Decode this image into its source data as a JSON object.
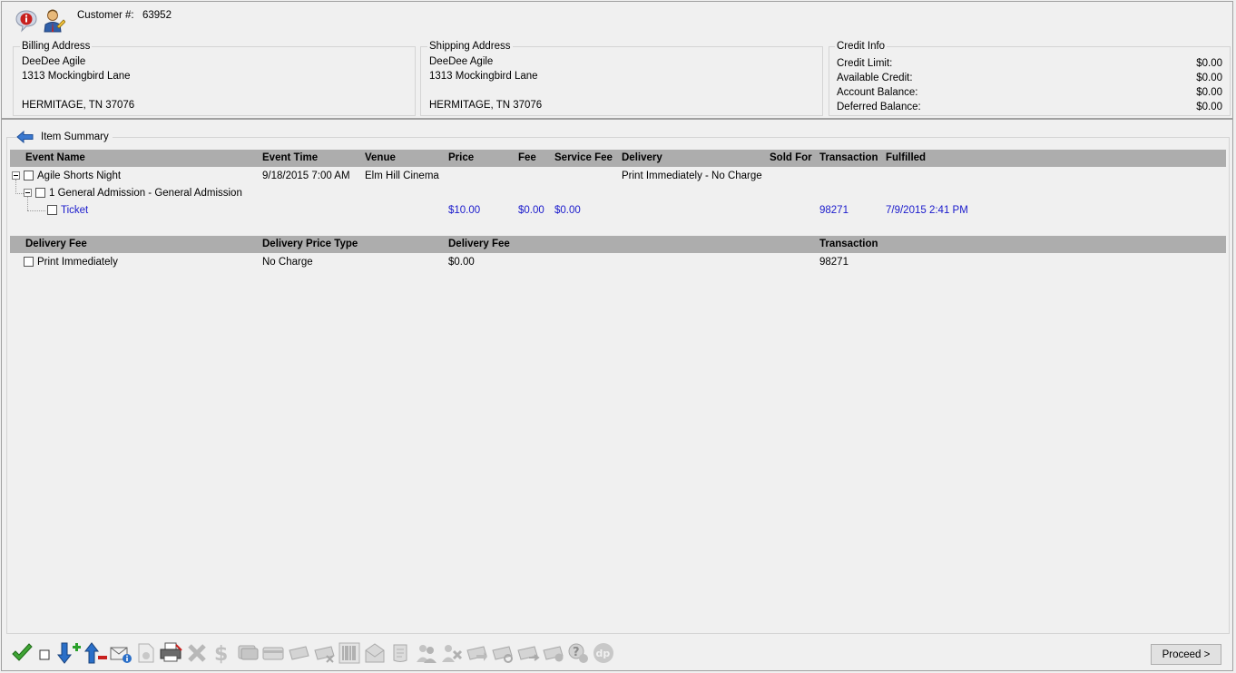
{
  "customer": {
    "label": "Customer #:",
    "number": "63952"
  },
  "billing": {
    "title": "Billing Address",
    "name": "DeeDee Agile",
    "street": "1313 Mockingbird Lane",
    "city": "HERMITAGE, TN 37076"
  },
  "shipping": {
    "title": "Shipping Address",
    "name": "DeeDee Agile",
    "street": "1313 Mockingbird Lane",
    "city": "HERMITAGE, TN 37076"
  },
  "credit": {
    "title": "Credit Info",
    "rows": [
      {
        "label": "Credit Limit:",
        "value": "$0.00"
      },
      {
        "label": "Available Credit:",
        "value": "$0.00"
      },
      {
        "label": "Account Balance:",
        "value": "$0.00"
      },
      {
        "label": "Deferred Balance:",
        "value": "$0.00"
      }
    ]
  },
  "summary": {
    "title": "Item Summary",
    "columns": [
      "Event Name",
      "Event Time",
      "Venue",
      "Price",
      "Fee",
      "Service Fee",
      "Delivery",
      "Sold For",
      "Transaction",
      "Fulfilled"
    ],
    "event": {
      "name": "Agile Shorts Night",
      "time": "9/18/2015 7:00 AM",
      "venue": "Elm Hill Cinema",
      "delivery": "Print Immediately - No Charge"
    },
    "admission": {
      "label": "1 General Admission - General Admission"
    },
    "ticket": {
      "label": "Ticket",
      "price": "$10.00",
      "fee": "$0.00",
      "service_fee": "$0.00",
      "transaction": "98271",
      "fulfilled": "7/9/2015 2:41 PM"
    }
  },
  "delivery_grid": {
    "columns": [
      "Delivery Fee",
      "Delivery Price Type",
      "Delivery Fee",
      "Transaction"
    ],
    "row": {
      "name": "Print Immediately",
      "price_type": "No Charge",
      "fee": "$0.00",
      "transaction": "98271"
    }
  },
  "toolbar": {
    "proceed_label": "Proceed >",
    "icons": [
      "check-icon",
      "checkbox-icon",
      "move-down-add-icon",
      "move-up-remove-icon",
      "email-info-icon",
      "document-info-icon",
      "printer-icon",
      "delete-icon",
      "dollar-icon",
      "cash-icon",
      "card-icon",
      "ticket-icon",
      "ticket-remove-icon",
      "barcode-icon",
      "envelope-icon",
      "scroll-icon",
      "group-icon",
      "group-remove-icon",
      "ticket-arrow-icon",
      "ticket-cancel-icon",
      "ticket-swap-icon",
      "ticket-refresh-icon",
      "help-icon",
      "dp-icon"
    ]
  },
  "colors": {
    "link_blue": "#1a1acc",
    "grid_header": "#adadad",
    "background": "#f0f0f0"
  }
}
